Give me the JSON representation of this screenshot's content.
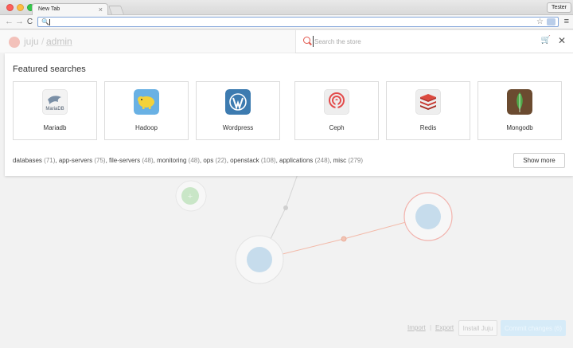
{
  "browser": {
    "tab_title": "New Tab",
    "tab_close": "×",
    "profile_name": "Tester",
    "omnibox_value": "",
    "omnibox_search_glyph": "🔍",
    "star_glyph": "☆",
    "menu_glyph": "≡",
    "back_glyph": "←",
    "forward_glyph": "→",
    "reload_glyph": "C"
  },
  "header": {
    "logo_text": "juju",
    "separator": "/",
    "user": "admin"
  },
  "search": {
    "placeholder": "Search the store",
    "cart_glyph": "🛒",
    "close_glyph": "✕"
  },
  "featured": {
    "title": "Featured searches",
    "cards": [
      {
        "label": "Mariadb",
        "icon": "mariadb-seal-icon",
        "icon_text": "MariaDB"
      },
      {
        "label": "Hadoop",
        "icon": "hadoop-elephant-icon"
      },
      {
        "label": "Wordpress",
        "icon": "wordpress-icon"
      },
      {
        "label": "Ceph",
        "icon": "ceph-icon"
      },
      {
        "label": "Redis",
        "icon": "redis-icon"
      },
      {
        "label": "Mongodb",
        "icon": "mongodb-leaf-icon"
      }
    ],
    "tags": [
      {
        "name": "databases",
        "count": "(71)"
      },
      {
        "name": "app-servers",
        "count": "(75)"
      },
      {
        "name": "file-servers",
        "count": "(48)"
      },
      {
        "name": "monitoring",
        "count": "(48)"
      },
      {
        "name": "ops",
        "count": "(22)"
      },
      {
        "name": "openstack",
        "count": "(108)"
      },
      {
        "name": "applications",
        "count": "(248)"
      },
      {
        "name": "misc",
        "count": "(279)"
      }
    ],
    "show_more_label": "Show more"
  },
  "canvas": {
    "add_glyph": "+"
  },
  "footer": {
    "import_label": "Import",
    "export_label": "Export",
    "separator": "|",
    "install_label": "Install Juju",
    "commit_label": "Commit changes (6)"
  },
  "colors": {
    "accent": "#e2584e",
    "hadoop": "#69b1e4",
    "wordpress": "#3d7bb0",
    "redis": "#c8342c",
    "mongodb": "#6b4b30"
  }
}
